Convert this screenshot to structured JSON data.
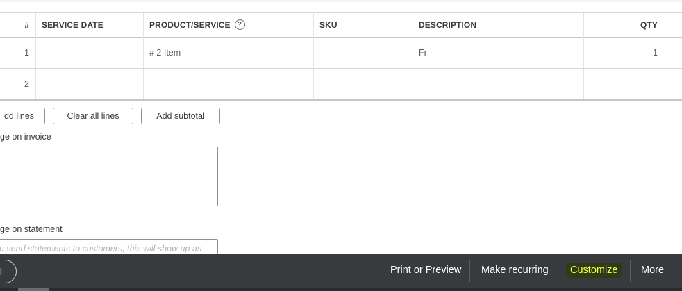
{
  "table": {
    "headers": {
      "num": "#",
      "service_date": "SERVICE DATE",
      "product_service": "PRODUCT/SERVICE",
      "sku": "SKU",
      "description": "DESCRIPTION",
      "qty": "QTY"
    },
    "help_icon": "?",
    "rows": [
      {
        "num": "1",
        "service_date": "",
        "product_service": "# 2 Item",
        "sku": "",
        "description": "Fr",
        "qty": "1"
      },
      {
        "num": "2",
        "service_date": "",
        "product_service": "",
        "sku": "",
        "description": "",
        "qty": ""
      }
    ]
  },
  "buttons": {
    "add_lines": "dd lines",
    "clear_all_lines": "Clear all lines",
    "add_subtotal": "Add subtotal"
  },
  "message_invoice": {
    "label": "ge on invoice",
    "value": ""
  },
  "message_statement": {
    "label": "ge on statement",
    "placeholder": "u send statements to customers, this will show up as"
  },
  "footer": {
    "left_pill": "l",
    "print_preview": "Print or Preview",
    "make_recurring": "Make recurring",
    "customize": "Customize",
    "more": "More"
  },
  "colors": {
    "footer_bg": "#393a3d",
    "highlight_text": "#f4ff3a",
    "border": "#d4d7dc"
  }
}
